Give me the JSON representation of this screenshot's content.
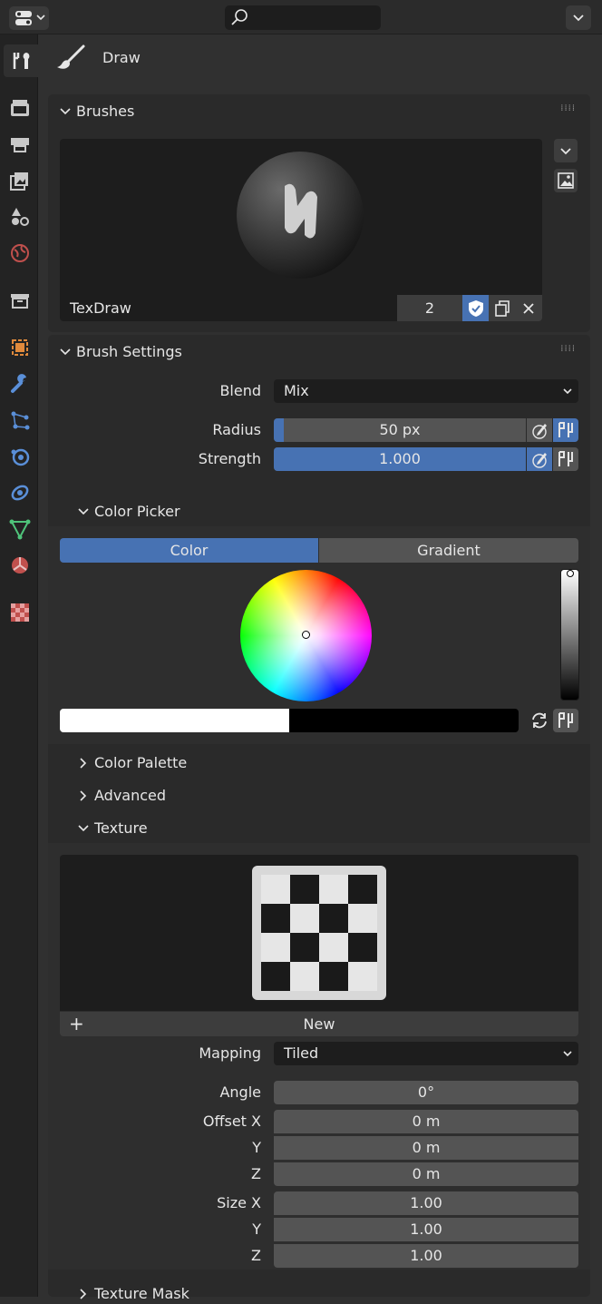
{
  "header": {
    "tool_name": "Draw"
  },
  "brushes": {
    "title": "Brushes",
    "brush_name": "TexDraw",
    "users_count": "2"
  },
  "brush_settings": {
    "title": "Brush Settings",
    "blend_label": "Blend",
    "blend_value": "Mix",
    "radius_label": "Radius",
    "radius_value": "50 px",
    "radius_fraction": 0.04,
    "strength_label": "Strength",
    "strength_value": "1.000",
    "strength_fraction": 1.0
  },
  "color_picker": {
    "title": "Color Picker",
    "tab_color": "Color",
    "tab_gradient": "Gradient",
    "active_tab": "Color",
    "current_color": "#ffffff",
    "secondary_color": "#000000"
  },
  "sections": {
    "color_palette": "Color Palette",
    "advanced": "Advanced",
    "texture": "Texture",
    "texture_mask": "Texture Mask"
  },
  "texture": {
    "new_label": "New",
    "mapping_label": "Mapping",
    "mapping_value": "Tiled",
    "angle_label": "Angle",
    "angle_value": "0°",
    "offset_x_label": "Offset X",
    "offset_x": "0 m",
    "offset_y_label": "Y",
    "offset_y": "0 m",
    "offset_z_label": "Z",
    "offset_z": "0 m",
    "size_x_label": "Size X",
    "size_x": "1.00",
    "size_y_label": "Y",
    "size_y": "1.00",
    "size_z_label": "Z",
    "size_z": "1.00"
  },
  "colors": {
    "accent": "#4772b3",
    "background": "#303030",
    "panel": "#2a2a2a",
    "field": "#545454"
  },
  "icons": {
    "tabs": [
      "tool-icon",
      "render-icon",
      "output-icon",
      "view-layer-icon",
      "scene-icon",
      "world-icon",
      "collection-icon",
      "object-icon",
      "modifier-icon",
      "particles-icon",
      "physics-icon",
      "constraints-icon",
      "data-icon",
      "material-icon",
      "texture-icon"
    ]
  }
}
